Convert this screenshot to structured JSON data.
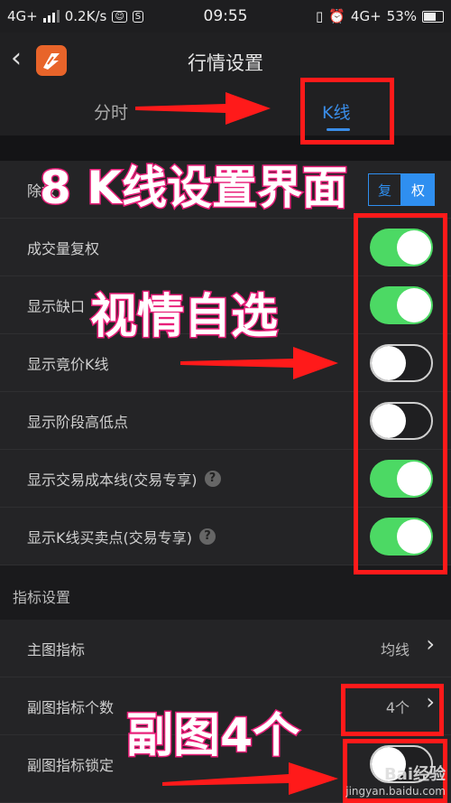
{
  "status_bar": {
    "left": "4G+",
    "speed": "0.2K/s",
    "time": "09:55",
    "network": "4G+",
    "battery": "53%"
  },
  "header": {
    "back_icon": "chevron-left-icon",
    "title": "行情设置"
  },
  "tabs": [
    {
      "label": "分时"
    },
    {
      "label": "K线"
    }
  ],
  "rows": [
    {
      "label": "除权"
    },
    {
      "label": "成交量复权",
      "toggle": "on"
    },
    {
      "label": "显示缺口",
      "toggle": "on"
    },
    {
      "label": "显示竟价K线",
      "toggle": "off"
    },
    {
      "label": "显示阶段高低点",
      "toggle": "off"
    },
    {
      "label": "显示交易成本线(交易专享)",
      "toggle": "on",
      "help": "?"
    },
    {
      "label": "显示K线买卖点(交易专享)",
      "toggle": "on",
      "help": "?"
    }
  ],
  "fuquan_options": [
    "复",
    "权"
  ],
  "section2": {
    "title": "指标设置",
    "rows": [
      {
        "label": "主图指标",
        "value": "均线"
      },
      {
        "label": "副图指标个数",
        "value": "4个"
      },
      {
        "label": "副图指标锁定",
        "toggle": "off"
      }
    ]
  },
  "annotations": {
    "title": "8 K线设置界面",
    "note1": "视情自选",
    "note2": "副图4个"
  },
  "watermark": {
    "brand": "Bai经验",
    "url": "jingyan.baidu.com"
  },
  "colors": {
    "accent": "#3a8de8",
    "toggle_on": "#4cd964",
    "annotation_red": "#ff1a1a",
    "annotation_pink": "#e8207a"
  }
}
